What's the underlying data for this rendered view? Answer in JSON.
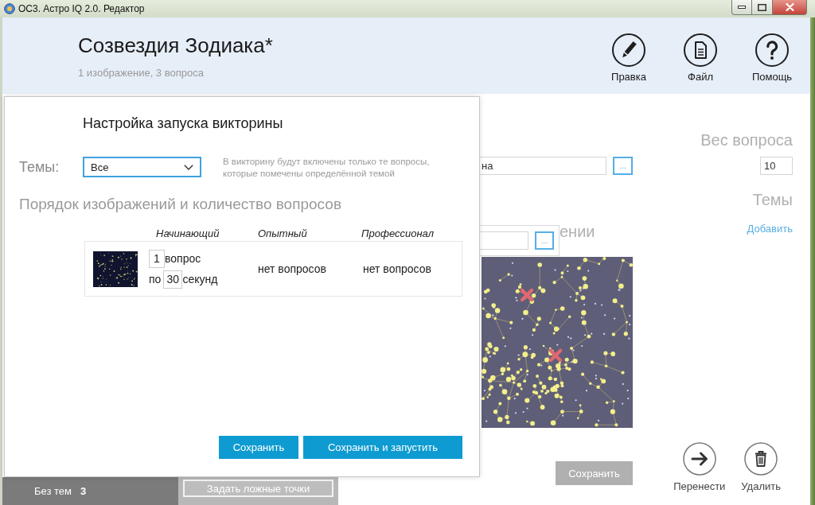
{
  "window": {
    "title": "ОС3. Астро IQ 2.0. Редактор"
  },
  "header": {
    "title": "Созвездия Зодиака*",
    "subtitle": "1 изображение, 3 вопроса",
    "actions": [
      {
        "kind": "edit",
        "label": "Правка"
      },
      {
        "kind": "file",
        "label": "Файл"
      },
      {
        "kind": "help",
        "label": "Помощь"
      }
    ]
  },
  "editor": {
    "name_field": {
      "value": "на",
      "browse_label": "..."
    },
    "picker_popup": {
      "browse_label": "..."
    },
    "image_heading": "ении",
    "save_button": {
      "label": "Сохранить",
      "disabled": true
    },
    "weight_label": "Вес вопроса",
    "weight_field": {
      "value": "10"
    },
    "topics_label": "Темы",
    "add_link": "Добавить",
    "actions": [
      {
        "kind": "move",
        "label": "Перенести"
      },
      {
        "kind": "delete",
        "label": "Удалить"
      }
    ]
  },
  "bottom_bar": {
    "topic_filter": {
      "label": "Без тем",
      "count": "3"
    },
    "fake_points_button": "Задать ложные точки"
  },
  "dialog": {
    "title": "Настройка запуска викторины",
    "topics_label": "Темы:",
    "topics_select": {
      "value": "Все"
    },
    "hint": "В викторину будут включены только те вопросы, которые помечены определённой темой",
    "order_heading": "Порядок изображений и количество вопросов",
    "columns": [
      "Начинающий",
      "Опытный",
      "Профессионал"
    ],
    "rows": [
      {
        "cells": [
          {
            "kind": "count",
            "count": "1",
            "count_unit": "вопрос",
            "per": "по",
            "seconds": "30",
            "seconds_unit": "секунд"
          },
          {
            "kind": "text",
            "text": "нет вопросов"
          },
          {
            "kind": "text",
            "text": "нет вопросов"
          }
        ]
      }
    ],
    "buttons": [
      "Сохранить",
      "Сохранить и запустить"
    ]
  }
}
